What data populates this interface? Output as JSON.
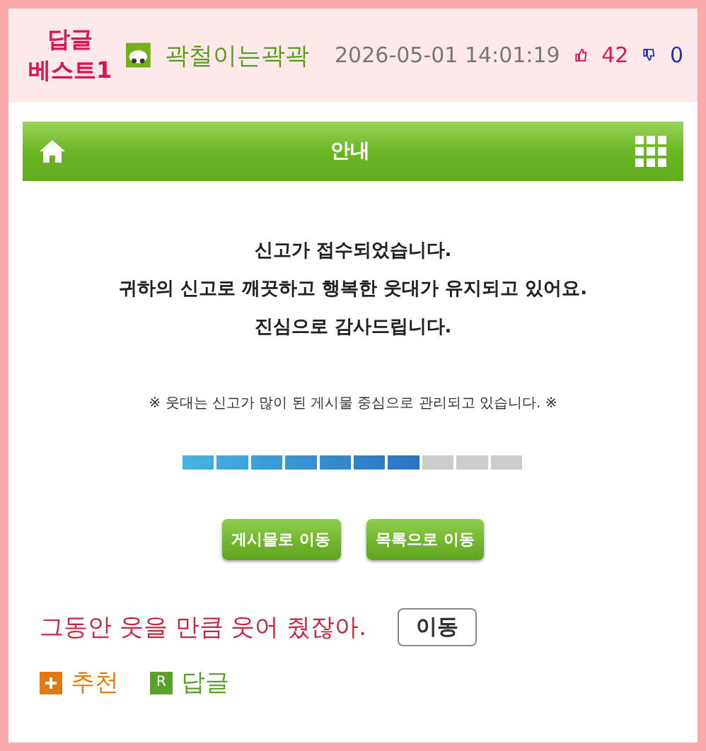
{
  "header": {
    "badge": "답글\n베스트1",
    "author": "곽철이는곽곽",
    "datetime": "2026-05-01 14:01:19",
    "likes": "42",
    "dislikes": "0"
  },
  "dialog": {
    "title": "안내",
    "messages": [
      "신고가 접수되었습니다.",
      "귀하의 신고로 깨끗하고 행복한 웃대가 유지되고 있어요.",
      "진심으로 감사드립니다."
    ],
    "note": "※ 웃대는 신고가 많이 된 게시물 중심으로 관리되고 있습니다. ※",
    "progress": {
      "level": 0.7
    },
    "buttons": [
      "게시물로 이동",
      "목록으로 이동"
    ]
  },
  "footer": {
    "comment": "그동안 웃을 만큼 웃어 줬잖아.",
    "move_button": "이동",
    "actions": [
      {
        "kind": "recommend",
        "label": "추천"
      },
      {
        "kind": "reply",
        "icon_letter": "R",
        "label": "답글"
      }
    ]
  }
}
